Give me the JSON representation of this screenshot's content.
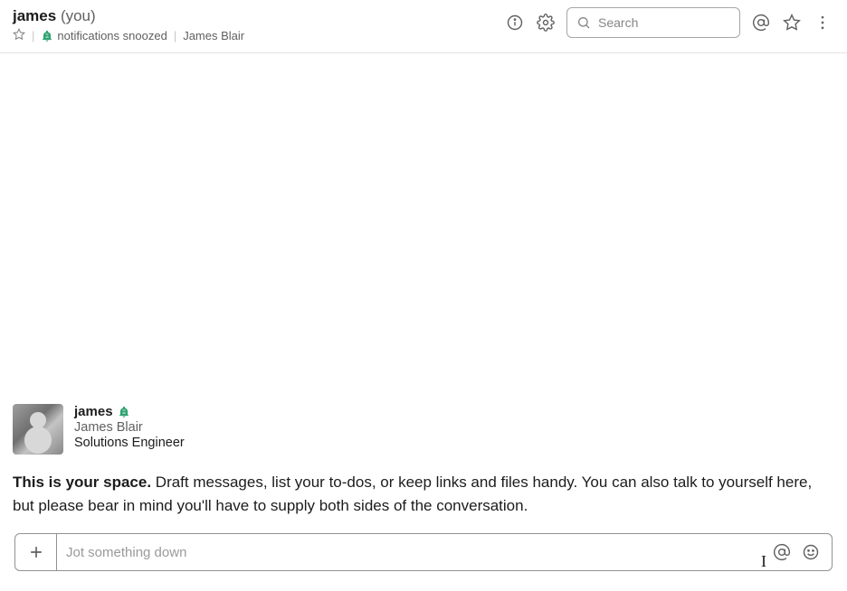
{
  "header": {
    "channel_name": "james",
    "you_suffix": "(you)",
    "notifications_label": "notifications snoozed",
    "full_name": "James Blair",
    "search_placeholder": "Search"
  },
  "profile": {
    "username": "james",
    "full_name": "James Blair",
    "role": "Solutions Engineer"
  },
  "space": {
    "intro_bold": "This is your space.",
    "intro_rest": " Draft messages, list your to-dos, or keep links and files handy. You can also talk to yourself here, but please bear in mind you'll have to supply both sides of the conversation."
  },
  "composer": {
    "placeholder": "Jot something down"
  }
}
